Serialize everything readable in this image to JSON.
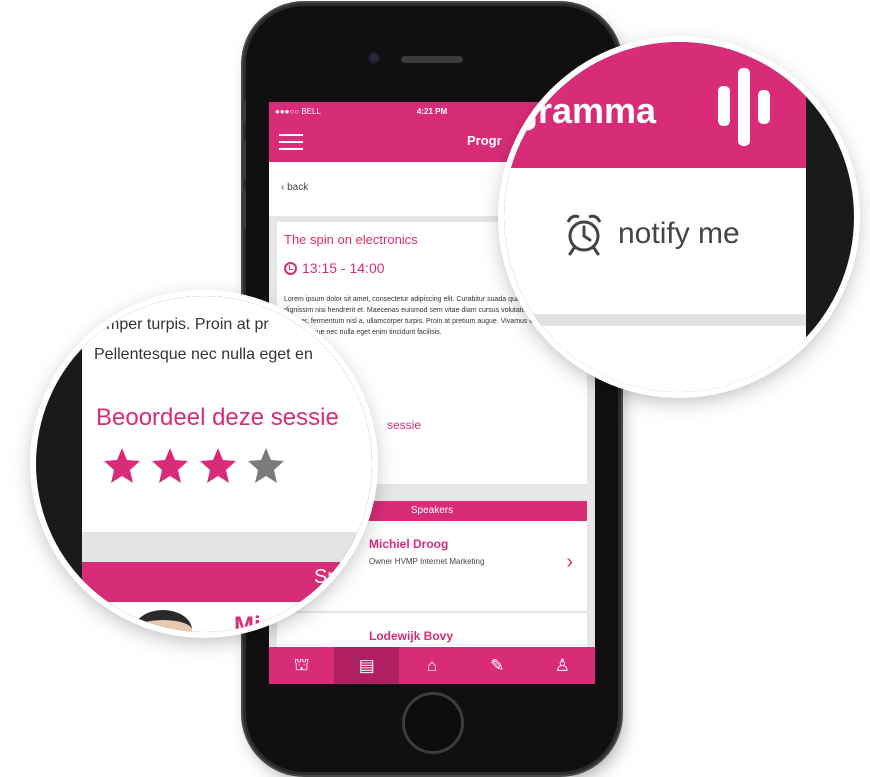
{
  "status": {
    "carrier": "●●●○○ BELL",
    "time": "4:21 PM"
  },
  "nav": {
    "title": "Progr"
  },
  "back": {
    "label": "‹ back"
  },
  "session": {
    "title": "The spin on electronics",
    "time": "13:15 - 14:00",
    "body": "Lorem ipsum dolor sit amet, consectetur adipiscing elit. Curabitur suada quam arcu, non dignissim nisi hendrerit et. Maecenas euismod sem vitae diam cursus volutate. Ut ut felis semper, fermentum nisl a, ullamcorper turpis. Proin at pretium augue. Vivamus et eleifend justo. Pellentesque nec nulla eget enim tincidunt facilisis.",
    "rate_label": "sessie"
  },
  "speakers": {
    "header": "Speakers",
    "items": [
      {
        "name": "Michiel Droog",
        "role": "Owner HVMP Internet Marketing"
      },
      {
        "name": "Lodewijk Bovy",
        "role": ""
      }
    ]
  },
  "tabs": [
    {
      "icon": "⛫",
      "name": "market"
    },
    {
      "icon": "▤",
      "name": "program"
    },
    {
      "icon": "⌂",
      "name": "home"
    },
    {
      "icon": "✎",
      "name": "notes"
    },
    {
      "icon": "♙",
      "name": "profile"
    }
  ],
  "zoom_right": {
    "title": "gramma",
    "notify": "notify me"
  },
  "zoom_left": {
    "line1": "mper turpis. Proin at pr",
    "line2": "Pellentesque nec nulla eget en",
    "rate_label": "Beoordeel deze sessie",
    "rating": 3,
    "rating_max": 4,
    "bar_label": "Spe",
    "name": "Mic"
  },
  "colors": {
    "accent": "#d92c78",
    "accent_dark": "#b21f60",
    "star_off": "#7a7a7a"
  }
}
